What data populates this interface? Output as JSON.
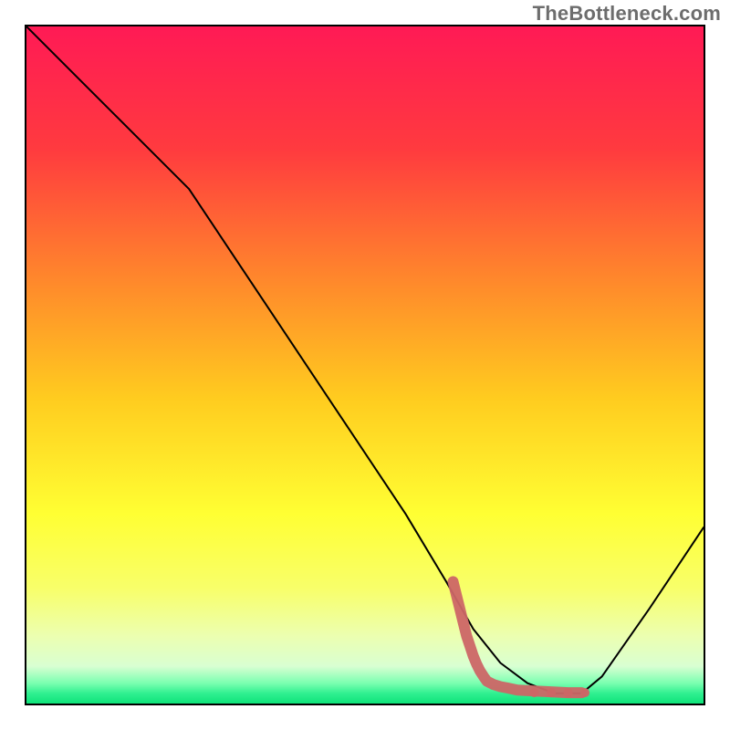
{
  "watermark": "TheBottleneck.com",
  "chart_data": {
    "type": "line",
    "title": "",
    "xlabel": "",
    "ylabel": "",
    "xlim": [
      0,
      100
    ],
    "ylim": [
      0,
      100
    ],
    "grid": false,
    "legend": null,
    "gradient_stops": [
      {
        "offset": 0.0,
        "color": "#ff1a55"
      },
      {
        "offset": 0.18,
        "color": "#ff3a3f"
      },
      {
        "offset": 0.38,
        "color": "#ff8a2b"
      },
      {
        "offset": 0.55,
        "color": "#ffcc1f"
      },
      {
        "offset": 0.72,
        "color": "#ffff33"
      },
      {
        "offset": 0.83,
        "color": "#f8ff6a"
      },
      {
        "offset": 0.9,
        "color": "#ecffb0"
      },
      {
        "offset": 0.945,
        "color": "#d9ffd2"
      },
      {
        "offset": 0.97,
        "color": "#7affb0"
      },
      {
        "offset": 0.985,
        "color": "#30f090"
      },
      {
        "offset": 1.0,
        "color": "#0fe37a"
      }
    ],
    "series": [
      {
        "name": "bottleneck-curve",
        "stroke": "#000000",
        "stroke_width": 2,
        "x": [
          0,
          8,
          16,
          24,
          28,
          36,
          46,
          56,
          62,
          66,
          70,
          74,
          78,
          82,
          85,
          92,
          100
        ],
        "y": [
          100,
          92,
          84,
          76,
          70,
          58,
          43,
          28,
          18,
          11,
          6,
          3,
          1.5,
          1.5,
          4,
          14,
          26
        ]
      }
    ],
    "highlight": {
      "name": "optimal-region-marker",
      "color": "#cc6666",
      "points": [
        {
          "x": 63,
          "y": 18
        },
        {
          "x": 63.5,
          "y": 16
        },
        {
          "x": 64,
          "y": 14
        },
        {
          "x": 64.5,
          "y": 12
        },
        {
          "x": 65,
          "y": 10
        },
        {
          "x": 65.5,
          "y": 8.5
        },
        {
          "x": 66,
          "y": 7
        },
        {
          "x": 66.5,
          "y": 5.8
        },
        {
          "x": 67,
          "y": 4.8
        },
        {
          "x": 67.5,
          "y": 4
        },
        {
          "x": 68,
          "y": 3.3
        },
        {
          "x": 69,
          "y": 2.8
        },
        {
          "x": 70,
          "y": 2.5
        },
        {
          "x": 71,
          "y": 2.3
        },
        {
          "x": 72.5,
          "y": 2.0
        },
        {
          "x": 74,
          "y": 1.9
        },
        {
          "x": 76,
          "y": 1.8
        },
        {
          "x": 78,
          "y": 1.7
        },
        {
          "x": 80,
          "y": 1.6
        },
        {
          "x": 82,
          "y": 1.6
        }
      ]
    }
  }
}
